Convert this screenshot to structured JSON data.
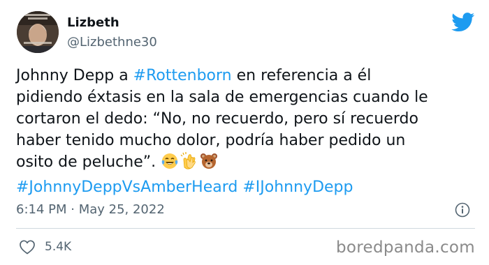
{
  "author": {
    "display_name": "Lizbeth",
    "handle": "@Lizbethne30"
  },
  "tweet": {
    "lines": [
      [
        {
          "text": "Johnny Depp a ",
          "kind": "text"
        },
        {
          "text": "#Rottenborn",
          "kind": "hashtag"
        },
        {
          "text": " en referencia a él",
          "kind": "text"
        }
      ],
      [
        {
          "text": "pidiendo éxtasis en la sala de emergencias cuando le",
          "kind": "text"
        }
      ],
      [
        {
          "text": "cortaron el dedo: “No, no recuerdo, pero sí recuerdo",
          "kind": "text"
        }
      ],
      [
        {
          "text": "haber tenido mucho dolor, podría haber pedido un",
          "kind": "text"
        }
      ],
      [
        {
          "text": "osito de peluche”. ",
          "kind": "text"
        },
        {
          "text": "tears-of-joy-emoji",
          "kind": "emoji"
        },
        {
          "text": "clapping-hands-emoji",
          "kind": "emoji"
        },
        {
          "text": "bear-face-emoji",
          "kind": "emoji"
        }
      ],
      [
        {
          "text": "#JohnnyDeppVsAmberHeard",
          "kind": "hashtag"
        },
        {
          "text": " ",
          "kind": "text"
        },
        {
          "text": "#IJohnnyDepp",
          "kind": "hashtag"
        }
      ]
    ]
  },
  "timestamp": "6:14 PM · May 25, 2022",
  "like_count": "5.4K",
  "watermark": "boredpanda.com",
  "colors": {
    "hashtag": "#1d9bf0",
    "twitter_blue": "#1d9bf0",
    "secondary_text": "#536471"
  },
  "icons": {
    "brand": "twitter-bird-icon",
    "info": "info-icon",
    "like": "heart-icon"
  }
}
